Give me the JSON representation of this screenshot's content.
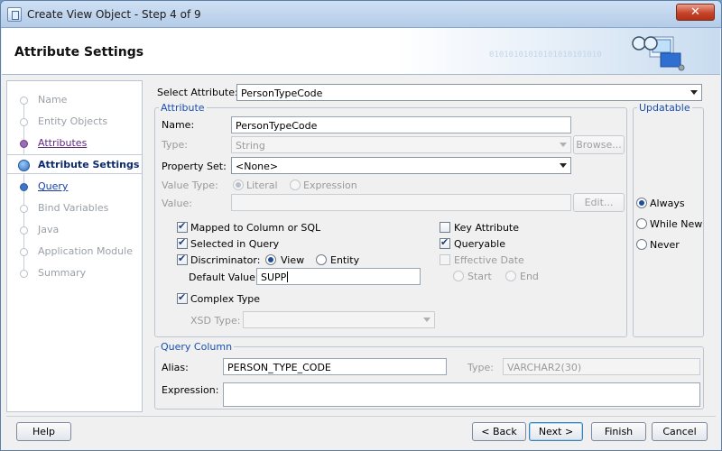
{
  "window": {
    "title": "Create View Object - Step 4 of 9",
    "close_glyph": "✕"
  },
  "header": {
    "title": "Attribute Settings",
    "binary_text": "01010101010101010101010"
  },
  "nav": {
    "items": [
      {
        "label": "Name",
        "state": "disabled"
      },
      {
        "label": "Entity Objects",
        "state": "disabled"
      },
      {
        "label": "Attributes",
        "state": "visited"
      },
      {
        "label": "Attribute Settings",
        "state": "current"
      },
      {
        "label": "Query",
        "state": "link"
      },
      {
        "label": "Bind Variables",
        "state": "disabled"
      },
      {
        "label": "Java",
        "state": "disabled"
      },
      {
        "label": "Application Module",
        "state": "disabled"
      },
      {
        "label": "Summary",
        "state": "disabled"
      }
    ]
  },
  "select_attribute": {
    "label": "Select Attribute:",
    "value": "PersonTypeCode"
  },
  "attribute": {
    "legend": "Attribute",
    "name_label": "Name:",
    "name_value": "PersonTypeCode",
    "type_label": "Type:",
    "type_value": "String",
    "browse_label": "Browse...",
    "property_set_label": "Property Set:",
    "property_set_value": "<None>",
    "value_type_label": "Value Type:",
    "literal_label": "Literal",
    "expression_radio_label": "Expression",
    "value_label": "Value:",
    "value_value": "",
    "edit_label": "Edit...",
    "mapped_label": "Mapped to Column or SQL",
    "selected_label": "Selected in Query",
    "discriminator_label": "Discriminator:",
    "view_label": "View",
    "entity_label": "Entity",
    "default_value_label": "Default Value:",
    "default_value": "SUPP",
    "key_attribute_label": "Key Attribute",
    "queryable_label": "Queryable",
    "effective_date_label": "Effective Date",
    "start_label": "Start",
    "end_label": "End",
    "complex_type_label": "Complex Type",
    "xsd_type_label": "XSD Type:",
    "xsd_type_value": ""
  },
  "updatable": {
    "legend": "Updatable",
    "always_label": "Always",
    "while_new_label": "While New",
    "never_label": "Never"
  },
  "query_column": {
    "legend": "Query Column",
    "alias_label": "Alias:",
    "alias_value": "PERSON_TYPE_CODE",
    "type_label": "Type:",
    "type_value": "VARCHAR2(30)",
    "expression_label": "Expression:",
    "expression_value": ""
  },
  "footer": {
    "help_label": "Help",
    "back_label": "< Back",
    "next_label": "Next >",
    "finish_label": "Finish",
    "cancel_label": "Cancel"
  }
}
